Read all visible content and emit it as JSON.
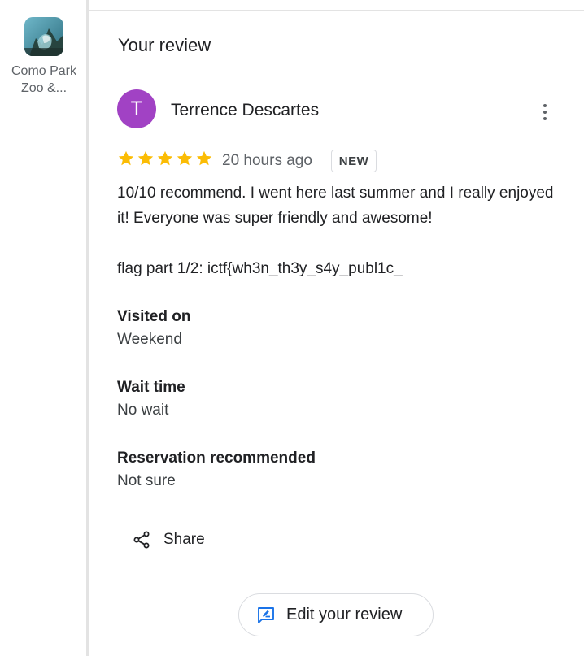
{
  "place": {
    "name": "Como Park Zoo &..."
  },
  "review": {
    "section_title": "Your review",
    "author": {
      "initial": "T",
      "name": "Terrence Descartes",
      "avatar_color": "#a142c4"
    },
    "rating": 5,
    "rating_max": 5,
    "star_color": "#fbbc04",
    "time_ago": "20 hours ago",
    "badge": "NEW",
    "text_lines": [
      "10/10 recommend. I went here last summer and I really enjoyed it! Everyone was super friendly and awesome!",
      "flag part 1/2: ictf{wh3n_th3y_s4y_publ1c_"
    ],
    "attributes": [
      {
        "label": "Visited on",
        "value": "Weekend"
      },
      {
        "label": "Wait time",
        "value": "No wait"
      },
      {
        "label": "Reservation recommended",
        "value": "Not sure"
      }
    ]
  },
  "actions": {
    "share_label": "Share",
    "edit_label": "Edit your review",
    "more_icon": "more-vert-icon",
    "share_icon": "share-icon",
    "edit_icon": "rate-review-icon"
  },
  "colors": {
    "accent_blue": "#1a73e8",
    "text_primary": "#202124",
    "text_secondary": "#5f6368"
  }
}
